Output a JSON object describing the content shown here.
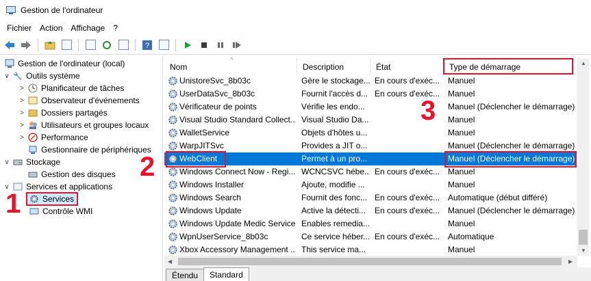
{
  "window": {
    "title": "Gestion de l'ordinateur"
  },
  "menu": [
    "Fichier",
    "Action",
    "Affichage",
    "?"
  ],
  "toolbar": [
    "back-arrow-icon",
    "forward-arrow-icon",
    "up-folder-icon",
    "show-hide-tree-icon",
    "properties-icon",
    "refresh-icon",
    "export-list-icon",
    "help-icon",
    "action-pane-icon",
    "play-icon",
    "stop-icon",
    "pause-icon",
    "restart-icon"
  ],
  "tree": {
    "root": "Gestion de l'ordinateur (local)",
    "system_tools": "Outils système",
    "system_items": [
      "Planificateur de tâches",
      "Observateur d'événements",
      "Dossiers partagés",
      "Utilisateurs et groupes locaux",
      "Performance",
      "Gestionnaire de périphériques"
    ],
    "storage": "Stockage",
    "disk_management": "Gestion des disques",
    "services_apps": "Services et applications",
    "services": "Services",
    "wmi": "Contrôle WMI"
  },
  "columns": {
    "name": "Nom",
    "description": "Description",
    "state": "État",
    "startup_type": "Type de démarrage"
  },
  "rows": [
    {
      "name": "UnistoreSvc_8b03c",
      "description": "Gère le stockage...",
      "state": "En cours d'exéc...",
      "type": "Manuel"
    },
    {
      "name": "UserDataSvc_8b03c",
      "description": "Fournit l'accès d...",
      "state": "En cours d'exéc...",
      "type": "Manuel"
    },
    {
      "name": "Vérificateur de points",
      "description": "Vérifie les endo...",
      "state": "",
      "type": "Manuel (Déclencher le démarrage)"
    },
    {
      "name": "Visual Studio Standard Collect...",
      "description": "Visual Studio Da...",
      "state": "",
      "type": "Manuel"
    },
    {
      "name": "WalletService",
      "description": "Objets d'hôtes u...",
      "state": "",
      "type": "Manuel"
    },
    {
      "name": "WarpJITSvc",
      "description": "Provides a JIT o...",
      "state": "",
      "type": "Manuel (Déclencher le démarrage)"
    },
    {
      "name": "WebClient",
      "description": "Permet à un pro...",
      "state": "",
      "type": "Manuel (Déclencher le démarrage)"
    },
    {
      "name": "Windows Connect Now - Regi...",
      "description": "WCNCSVC hébe...",
      "state": "En cours d'exéc...",
      "type": "Manuel"
    },
    {
      "name": "Windows Installer",
      "description": "Ajoute, modifie ...",
      "state": "",
      "type": "Manuel"
    },
    {
      "name": "Windows Search",
      "description": "Fournit des fonc...",
      "state": "En cours d'exéc...",
      "type": "Automatique (début différé)"
    },
    {
      "name": "Windows Update",
      "description": "Active la détecti...",
      "state": "En cours d'exéc...",
      "type": "Manuel (Déclencher le démarrage)"
    },
    {
      "name": "Windows Update Medic Service",
      "description": "Enables remedia...",
      "state": "",
      "type": "Manuel"
    },
    {
      "name": "WpnUserService_8b03c",
      "description": "Ce service héber...",
      "state": "En cours d'exéc...",
      "type": "Automatique"
    },
    {
      "name": "Xbox Accessory Management ...",
      "description": "This service ma...",
      "state": "",
      "type": "Manuel"
    }
  ],
  "selected_row": "WebClient",
  "tabs": [
    "Étendu",
    "Standard"
  ],
  "active_tab": "Standard",
  "callouts": [
    "1",
    "2",
    "3"
  ],
  "colors": {
    "selection": "#0078d7",
    "highlight": "#e8132b",
    "tree_selected": "#cce8ff"
  }
}
